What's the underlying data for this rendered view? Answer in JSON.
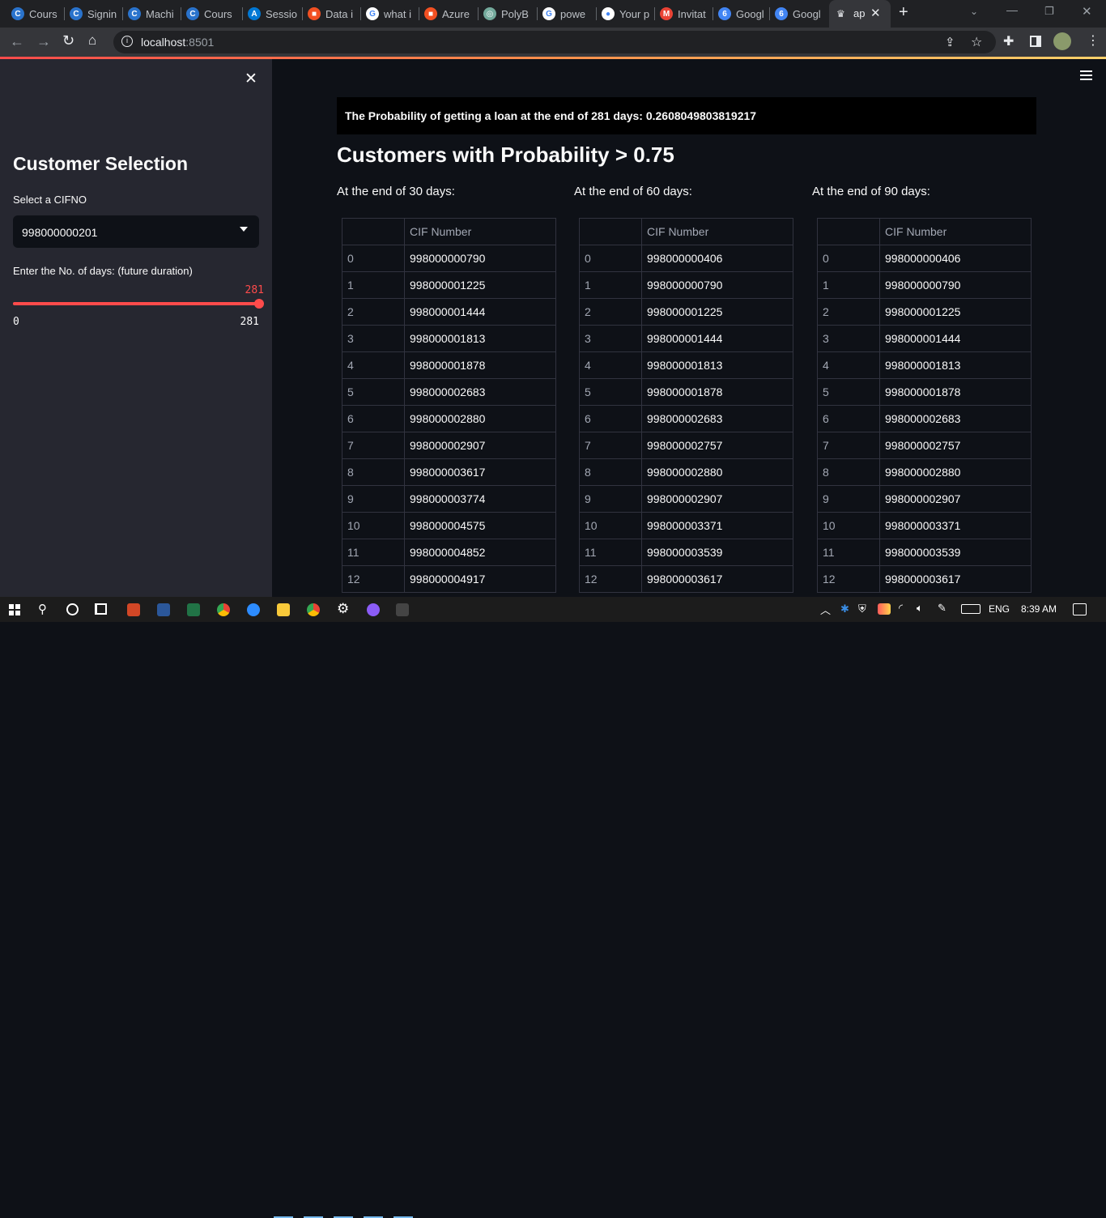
{
  "browser": {
    "tabs": [
      {
        "label": "Cours",
        "icon": "coursera-icon",
        "color": "#2a73cc",
        "glyph": "C"
      },
      {
        "label": "Signin",
        "icon": "coursera-icon",
        "color": "#2a73cc",
        "glyph": "C"
      },
      {
        "label": "Machi",
        "icon": "coursera-icon",
        "color": "#2a73cc",
        "glyph": "C"
      },
      {
        "label": "Cours",
        "icon": "coursera-icon",
        "color": "#2a73cc",
        "glyph": "C"
      },
      {
        "label": "Sessio",
        "icon": "azure-icon",
        "color": "#0078d4",
        "glyph": "A"
      },
      {
        "label": "Data i",
        "icon": "microsoft-icon",
        "color": "#f25022",
        "glyph": "■"
      },
      {
        "label": "what i",
        "icon": "google-icon",
        "color": "#ffffff",
        "glyph": "G"
      },
      {
        "label": "Azure",
        "icon": "microsoft-icon",
        "color": "#f25022",
        "glyph": "■"
      },
      {
        "label": "PolyB",
        "icon": "openai-icon",
        "color": "#74aa9c",
        "glyph": "◎"
      },
      {
        "label": "powe",
        "icon": "google-icon",
        "color": "#ffffff",
        "glyph": "G"
      },
      {
        "label": "Your p",
        "icon": "github-icon",
        "color": "#ffffff",
        "glyph": "●"
      },
      {
        "label": "Invitat",
        "icon": "gmail-icon",
        "color": "#ea4335",
        "glyph": "M"
      },
      {
        "label": "Googl",
        "icon": "google-calendar-icon",
        "color": "#4285f4",
        "glyph": "6"
      },
      {
        "label": "Googl",
        "icon": "google-calendar-icon",
        "color": "#4285f4",
        "glyph": "6"
      }
    ],
    "active_tab": {
      "label": "ap",
      "icon": "streamlit-icon"
    },
    "url_host": "localhost",
    "url_port": ":8501"
  },
  "sidebar": {
    "title": "Customer Selection",
    "select_label": "Select a CIFNO",
    "select_value": "998000000201",
    "slider_label": "Enter the No. of days: (future duration)",
    "slider_value": "281",
    "slider_min": "0",
    "slider_max": "281",
    "slider_fraction": 1.0
  },
  "main": {
    "probability_text": "The Probability of getting a loan at the end of 281 days: 0.2608049803819217",
    "heading": "Customers with Probability > 0.75",
    "column_header": "CIF Number",
    "tables": [
      {
        "caption": "At the end of 30 days:",
        "rows": [
          "998000000790",
          "998000001225",
          "998000001444",
          "998000001813",
          "998000001878",
          "998000002683",
          "998000002880",
          "998000002907",
          "998000003617",
          "998000003774",
          "998000004575",
          "998000004852",
          "998000004917"
        ]
      },
      {
        "caption": "At the end of 60 days:",
        "rows": [
          "998000000406",
          "998000000790",
          "998000001225",
          "998000001444",
          "998000001813",
          "998000001878",
          "998000002683",
          "998000002757",
          "998000002880",
          "998000002907",
          "998000003371",
          "998000003539",
          "998000003617"
        ]
      },
      {
        "caption": "At the end of 90 days:",
        "rows": [
          "998000000406",
          "998000000790",
          "998000001225",
          "998000001444",
          "998000001813",
          "998000001878",
          "998000002683",
          "998000002757",
          "998000002880",
          "998000002907",
          "998000003371",
          "998000003539",
          "998000003617"
        ]
      }
    ]
  },
  "taskbar": {
    "language": "ENG",
    "time": "8:39 AM"
  },
  "colors": {
    "accent": "#ff4b4b",
    "sidebar_bg": "#262730",
    "main_bg": "#0e1117"
  }
}
